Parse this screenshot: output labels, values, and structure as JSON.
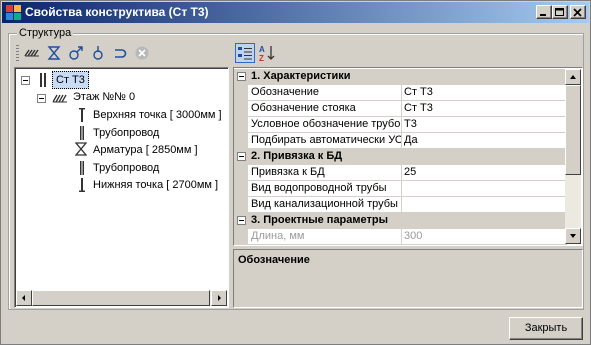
{
  "window": {
    "title": "Свойства конструктива (Ст Т3)"
  },
  "groupbox": {
    "label": "Структура"
  },
  "toolbar": {
    "icons": [
      "hatch-icon",
      "valve-icon",
      "riser-icon",
      "point-icon",
      "return-icon",
      "delete-icon"
    ]
  },
  "tree": {
    "root": "Ст Т3",
    "floor": "Этаж №№ 0",
    "items": [
      "Верхняя точка [ 3000мм ]",
      "Трубопровод",
      "Арматура [ 2850мм ]",
      "Трубопровод",
      "Нижняя точка [ 2700мм ]"
    ]
  },
  "grid": {
    "categories": [
      {
        "title": "1. Характеристики"
      },
      {
        "title": "2. Привязка к БД"
      },
      {
        "title": "3. Проектные параметры"
      }
    ],
    "props": [
      {
        "name": "Обозначение",
        "value": "Ст Т3"
      },
      {
        "name": "Обозначение стояка",
        "value": "Ст Т3"
      },
      {
        "name": "Условное обозначение трубо",
        "value": "Т3"
      },
      {
        "name": "Подбирать автоматически УО",
        "value": "Да"
      },
      {
        "name": "Привязка к БД",
        "value": "25"
      },
      {
        "name": "Вид водопроводной трубы",
        "value": ""
      },
      {
        "name": "Вид канализационной трубы",
        "value": ""
      },
      {
        "name": "Длина, мм",
        "value": "300"
      }
    ]
  },
  "description": {
    "title": "Обозначение"
  },
  "buttons": {
    "close": "Закрыть"
  },
  "colors": {
    "titlebar_start": "#0a246a",
    "titlebar_end": "#a6caf0",
    "selection": "#c8dcf5"
  }
}
